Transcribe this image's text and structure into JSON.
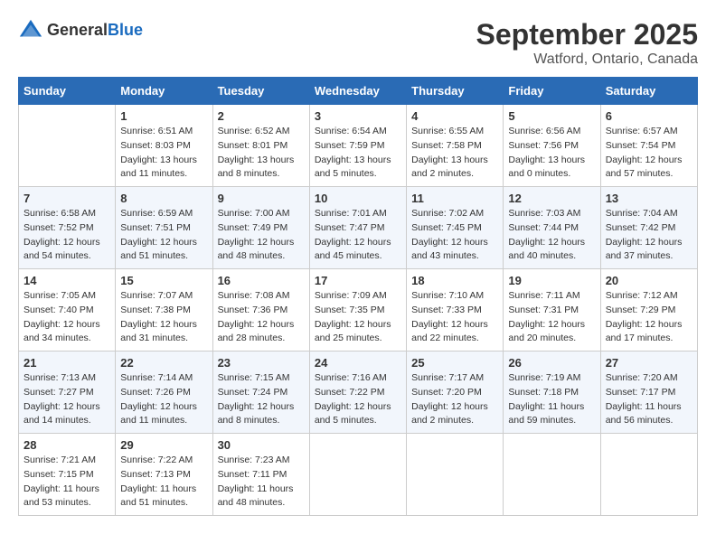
{
  "header": {
    "logo_general": "General",
    "logo_blue": "Blue",
    "month_year": "September 2025",
    "location": "Watford, Ontario, Canada"
  },
  "days_of_week": [
    "Sunday",
    "Monday",
    "Tuesday",
    "Wednesday",
    "Thursday",
    "Friday",
    "Saturday"
  ],
  "weeks": [
    [
      {
        "day": "",
        "sunrise": "",
        "sunset": "",
        "daylight": ""
      },
      {
        "day": "1",
        "sunrise": "Sunrise: 6:51 AM",
        "sunset": "Sunset: 8:03 PM",
        "daylight": "Daylight: 13 hours and 11 minutes."
      },
      {
        "day": "2",
        "sunrise": "Sunrise: 6:52 AM",
        "sunset": "Sunset: 8:01 PM",
        "daylight": "Daylight: 13 hours and 8 minutes."
      },
      {
        "day": "3",
        "sunrise": "Sunrise: 6:54 AM",
        "sunset": "Sunset: 7:59 PM",
        "daylight": "Daylight: 13 hours and 5 minutes."
      },
      {
        "day": "4",
        "sunrise": "Sunrise: 6:55 AM",
        "sunset": "Sunset: 7:58 PM",
        "daylight": "Daylight: 13 hours and 2 minutes."
      },
      {
        "day": "5",
        "sunrise": "Sunrise: 6:56 AM",
        "sunset": "Sunset: 7:56 PM",
        "daylight": "Daylight: 13 hours and 0 minutes."
      },
      {
        "day": "6",
        "sunrise": "Sunrise: 6:57 AM",
        "sunset": "Sunset: 7:54 PM",
        "daylight": "Daylight: 12 hours and 57 minutes."
      }
    ],
    [
      {
        "day": "7",
        "sunrise": "Sunrise: 6:58 AM",
        "sunset": "Sunset: 7:52 PM",
        "daylight": "Daylight: 12 hours and 54 minutes."
      },
      {
        "day": "8",
        "sunrise": "Sunrise: 6:59 AM",
        "sunset": "Sunset: 7:51 PM",
        "daylight": "Daylight: 12 hours and 51 minutes."
      },
      {
        "day": "9",
        "sunrise": "Sunrise: 7:00 AM",
        "sunset": "Sunset: 7:49 PM",
        "daylight": "Daylight: 12 hours and 48 minutes."
      },
      {
        "day": "10",
        "sunrise": "Sunrise: 7:01 AM",
        "sunset": "Sunset: 7:47 PM",
        "daylight": "Daylight: 12 hours and 45 minutes."
      },
      {
        "day": "11",
        "sunrise": "Sunrise: 7:02 AM",
        "sunset": "Sunset: 7:45 PM",
        "daylight": "Daylight: 12 hours and 43 minutes."
      },
      {
        "day": "12",
        "sunrise": "Sunrise: 7:03 AM",
        "sunset": "Sunset: 7:44 PM",
        "daylight": "Daylight: 12 hours and 40 minutes."
      },
      {
        "day": "13",
        "sunrise": "Sunrise: 7:04 AM",
        "sunset": "Sunset: 7:42 PM",
        "daylight": "Daylight: 12 hours and 37 minutes."
      }
    ],
    [
      {
        "day": "14",
        "sunrise": "Sunrise: 7:05 AM",
        "sunset": "Sunset: 7:40 PM",
        "daylight": "Daylight: 12 hours and 34 minutes."
      },
      {
        "day": "15",
        "sunrise": "Sunrise: 7:07 AM",
        "sunset": "Sunset: 7:38 PM",
        "daylight": "Daylight: 12 hours and 31 minutes."
      },
      {
        "day": "16",
        "sunrise": "Sunrise: 7:08 AM",
        "sunset": "Sunset: 7:36 PM",
        "daylight": "Daylight: 12 hours and 28 minutes."
      },
      {
        "day": "17",
        "sunrise": "Sunrise: 7:09 AM",
        "sunset": "Sunset: 7:35 PM",
        "daylight": "Daylight: 12 hours and 25 minutes."
      },
      {
        "day": "18",
        "sunrise": "Sunrise: 7:10 AM",
        "sunset": "Sunset: 7:33 PM",
        "daylight": "Daylight: 12 hours and 22 minutes."
      },
      {
        "day": "19",
        "sunrise": "Sunrise: 7:11 AM",
        "sunset": "Sunset: 7:31 PM",
        "daylight": "Daylight: 12 hours and 20 minutes."
      },
      {
        "day": "20",
        "sunrise": "Sunrise: 7:12 AM",
        "sunset": "Sunset: 7:29 PM",
        "daylight": "Daylight: 12 hours and 17 minutes."
      }
    ],
    [
      {
        "day": "21",
        "sunrise": "Sunrise: 7:13 AM",
        "sunset": "Sunset: 7:27 PM",
        "daylight": "Daylight: 12 hours and 14 minutes."
      },
      {
        "day": "22",
        "sunrise": "Sunrise: 7:14 AM",
        "sunset": "Sunset: 7:26 PM",
        "daylight": "Daylight: 12 hours and 11 minutes."
      },
      {
        "day": "23",
        "sunrise": "Sunrise: 7:15 AM",
        "sunset": "Sunset: 7:24 PM",
        "daylight": "Daylight: 12 hours and 8 minutes."
      },
      {
        "day": "24",
        "sunrise": "Sunrise: 7:16 AM",
        "sunset": "Sunset: 7:22 PM",
        "daylight": "Daylight: 12 hours and 5 minutes."
      },
      {
        "day": "25",
        "sunrise": "Sunrise: 7:17 AM",
        "sunset": "Sunset: 7:20 PM",
        "daylight": "Daylight: 12 hours and 2 minutes."
      },
      {
        "day": "26",
        "sunrise": "Sunrise: 7:19 AM",
        "sunset": "Sunset: 7:18 PM",
        "daylight": "Daylight: 11 hours and 59 minutes."
      },
      {
        "day": "27",
        "sunrise": "Sunrise: 7:20 AM",
        "sunset": "Sunset: 7:17 PM",
        "daylight": "Daylight: 11 hours and 56 minutes."
      }
    ],
    [
      {
        "day": "28",
        "sunrise": "Sunrise: 7:21 AM",
        "sunset": "Sunset: 7:15 PM",
        "daylight": "Daylight: 11 hours and 53 minutes."
      },
      {
        "day": "29",
        "sunrise": "Sunrise: 7:22 AM",
        "sunset": "Sunset: 7:13 PM",
        "daylight": "Daylight: 11 hours and 51 minutes."
      },
      {
        "day": "30",
        "sunrise": "Sunrise: 7:23 AM",
        "sunset": "Sunset: 7:11 PM",
        "daylight": "Daylight: 11 hours and 48 minutes."
      },
      {
        "day": "",
        "sunrise": "",
        "sunset": "",
        "daylight": ""
      },
      {
        "day": "",
        "sunrise": "",
        "sunset": "",
        "daylight": ""
      },
      {
        "day": "",
        "sunrise": "",
        "sunset": "",
        "daylight": ""
      },
      {
        "day": "",
        "sunrise": "",
        "sunset": "",
        "daylight": ""
      }
    ]
  ]
}
